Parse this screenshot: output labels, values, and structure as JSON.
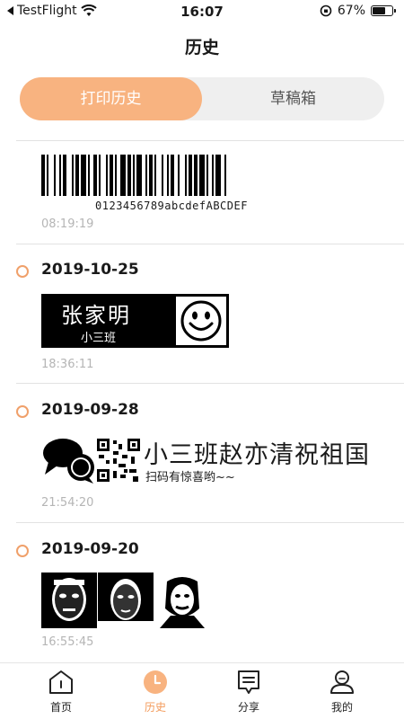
{
  "status_bar": {
    "back_app": "TestFlight",
    "time": "16:07",
    "battery": "67%",
    "battery_level": 0.67
  },
  "header": {
    "title": "历史"
  },
  "segment": {
    "tabs": [
      {
        "label": "打印历史",
        "active": true
      },
      {
        "label": "草稿箱",
        "active": false
      }
    ]
  },
  "entries": [
    {
      "date": "",
      "time": "08:19:19",
      "content_type": "barcode",
      "barcode_text": "0123456789abcdefABCDEF"
    },
    {
      "date": "2019-10-25",
      "time": "18:36:11",
      "content_type": "name-label",
      "name": "张家明",
      "class": "小三班"
    },
    {
      "date": "2019-09-28",
      "time": "21:54:20",
      "content_type": "banner",
      "headline": "小三班赵亦清祝祖国",
      "subline": "扫码有惊喜哟~~"
    },
    {
      "date": "2019-09-20",
      "time": "16:55:45",
      "content_type": "photos"
    }
  ],
  "tab_bar": {
    "tabs": [
      {
        "label": "首页",
        "icon": "home-icon",
        "active": false
      },
      {
        "label": "历史",
        "icon": "history-icon",
        "active": true
      },
      {
        "label": "分享",
        "icon": "share-icon",
        "active": false
      },
      {
        "label": "我的",
        "icon": "profile-icon",
        "active": false
      }
    ]
  },
  "colors": {
    "accent": "#f8b380",
    "accent_text": "#f39a5a",
    "dot": "#f0a06a",
    "muted": "#b5b5b5"
  }
}
